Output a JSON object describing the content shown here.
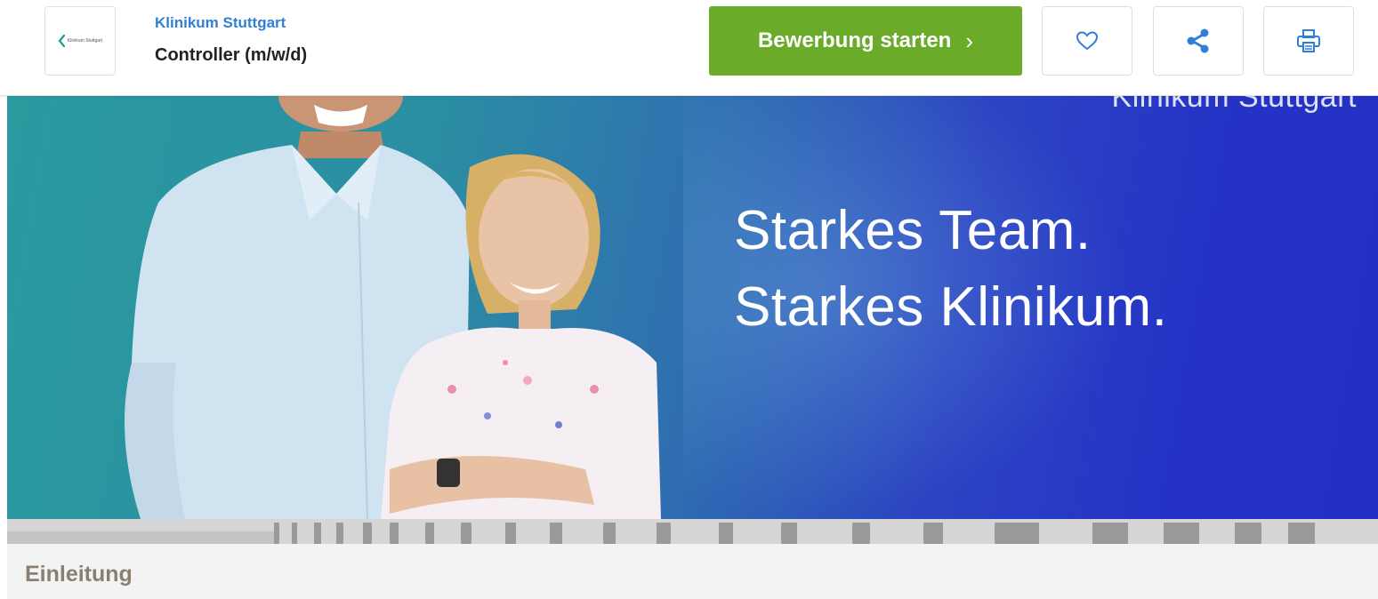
{
  "header": {
    "logo_text": "Klinikum Stuttgart",
    "company": "Klinikum Stuttgart",
    "job_title": "Controller (m/w/d)",
    "apply_label": "Bewerbung starten",
    "apply_chevron": "›",
    "icons": {
      "favorite": "heart-icon",
      "share": "share-icon",
      "print": "printer-icon"
    }
  },
  "hero": {
    "brand": "Klinikum Stuttgart",
    "headline_line1": "Starkes Team.",
    "headline_line2": "Starkes Klinikum."
  },
  "section": {
    "title": "Einleitung"
  },
  "colors": {
    "accent_green": "#6aab29",
    "link_blue": "#2f7fd6",
    "icon_blue": "#2f7fd6",
    "section_title": "#8b7f72"
  }
}
